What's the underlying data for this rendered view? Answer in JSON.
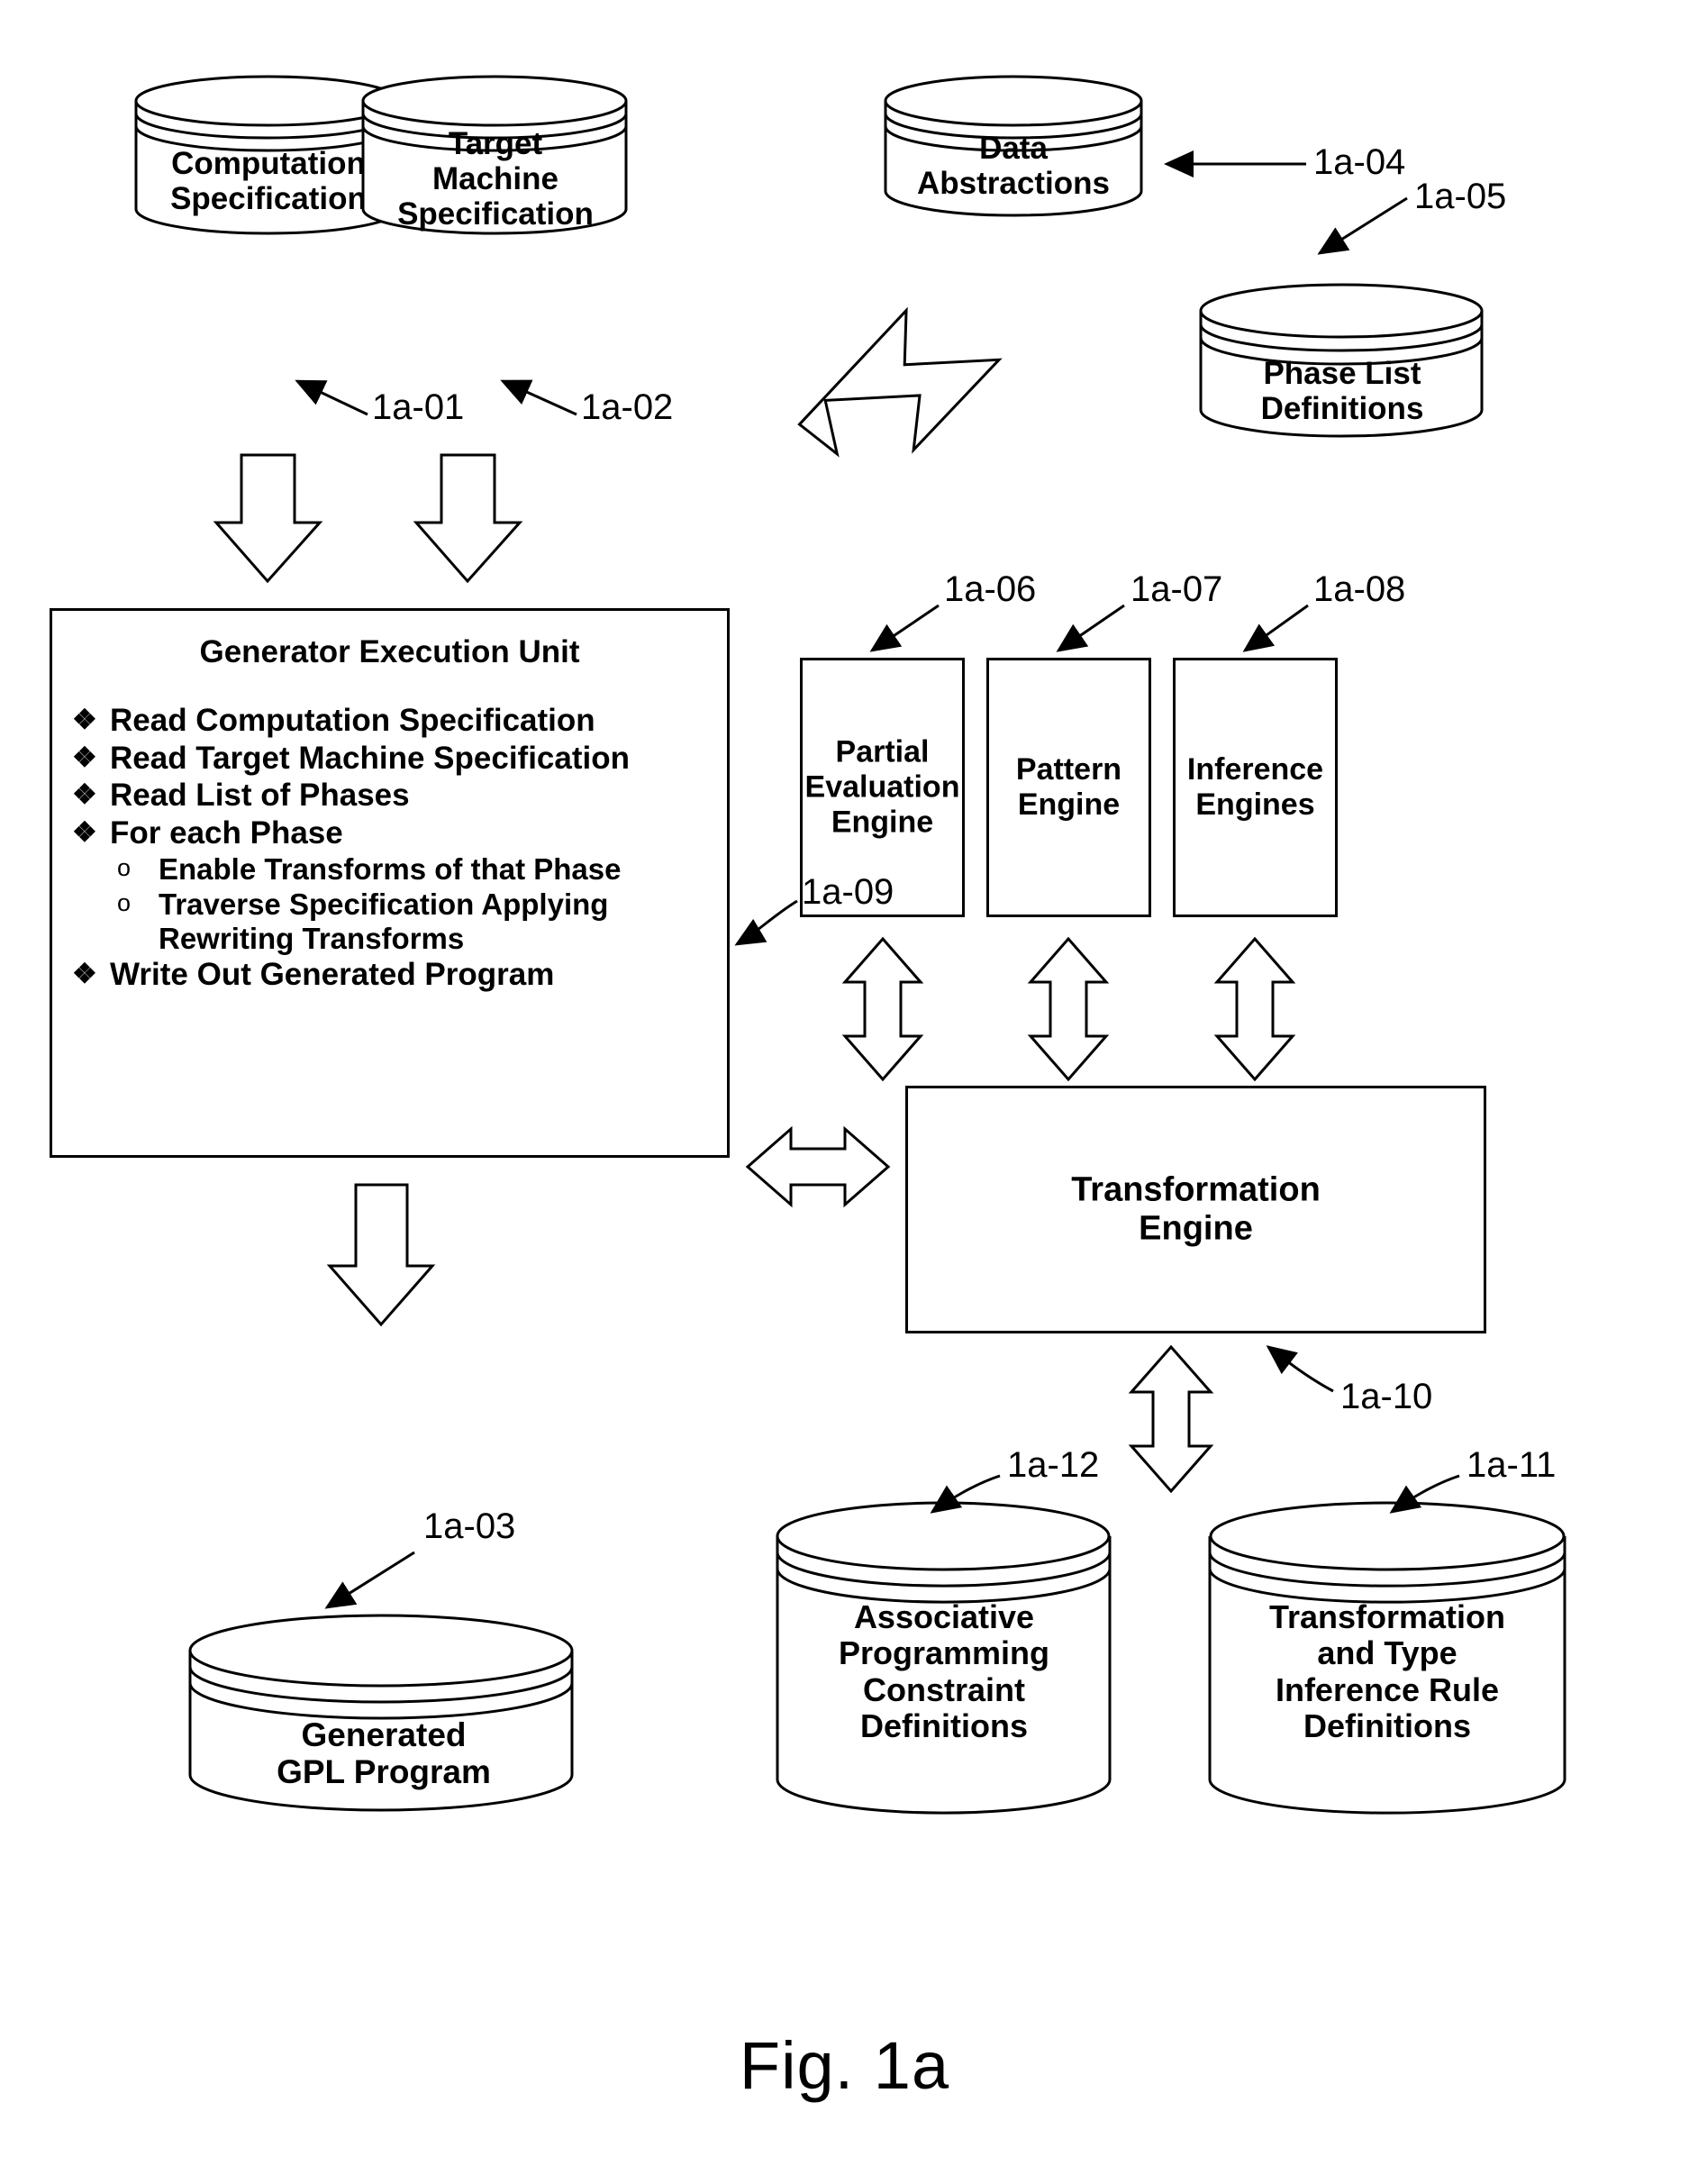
{
  "figure": {
    "caption": "Fig. 1a"
  },
  "databases": {
    "computation_specification": {
      "label": "Computation\nSpecification",
      "ref": "1a-01"
    },
    "target_machine_specification": {
      "label": "Target\nMachine\nSpecification",
      "ref": "1a-02"
    },
    "data_abstractions": {
      "label": "Data\nAbstractions",
      "ref": "1a-04"
    },
    "phase_list_definitions": {
      "label": "Phase List\nDefinitions",
      "ref": "1a-05"
    },
    "generated_gpl_program": {
      "label": "Generated\nGPL Program",
      "ref": "1a-03"
    },
    "associative_programming_constraint_definitions": {
      "label": "Associative\nProgramming\nConstraint\nDefinitions",
      "ref": "1a-12"
    },
    "transformation_type_inference_rule_definitions": {
      "label": "Transformation\nand Type\nInference Rule\nDefinitions",
      "ref": "1a-11"
    }
  },
  "generator_execution_unit": {
    "title": "Generator Execution Unit",
    "ref": "1a-09",
    "bullet_marker": "❖",
    "sub_bullet_marker": "o",
    "items": [
      {
        "level": 1,
        "text": "Read Computation Specification"
      },
      {
        "level": 1,
        "text": "Read Target Machine Specification"
      },
      {
        "level": 1,
        "text": "Read List of Phases"
      },
      {
        "level": 1,
        "text": "For each Phase"
      },
      {
        "level": 2,
        "text": "Enable Transforms of that Phase"
      },
      {
        "level": 2,
        "text": "Traverse Specification Applying Rewriting Transforms"
      },
      {
        "level": 1,
        "text": "Write Out Generated Program"
      }
    ]
  },
  "engines": {
    "partial_evaluation_engine": {
      "label": "Partial\nEvaluation\nEngine",
      "ref": "1a-06"
    },
    "pattern_engine": {
      "label": "Pattern\nEngine",
      "ref": "1a-07"
    },
    "inference_engines": {
      "label": "Inference\nEngines",
      "ref": "1a-08"
    },
    "transformation_engine": {
      "label": "Transformation\nEngine",
      "ref": "1a-10"
    }
  },
  "refs": {
    "r01": "1a-01",
    "r02": "1a-02",
    "r03": "1a-03",
    "r04": "1a-04",
    "r05": "1a-05",
    "r06": "1a-06",
    "r07": "1a-07",
    "r08": "1a-08",
    "r09": "1a-09",
    "r10": "1a-10",
    "r11": "1a-11",
    "r12": "1a-12"
  },
  "colors": {
    "stroke": "#000000",
    "fill": "#ffffff",
    "text": "#000000"
  }
}
